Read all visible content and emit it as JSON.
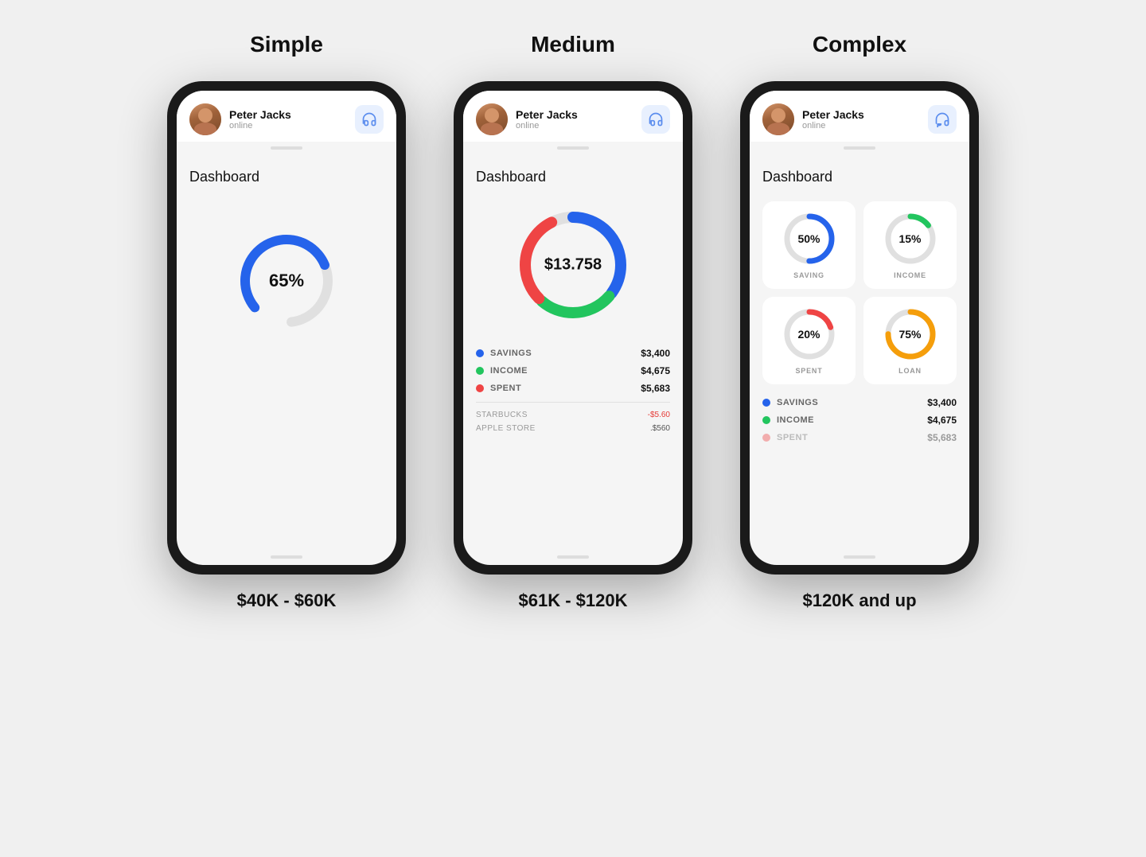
{
  "page": {
    "background": "#f0f0f0"
  },
  "columns": [
    {
      "id": "simple",
      "title": "Simple",
      "price_range": "$40K - $60K",
      "user": {
        "name": "Peter Jacks",
        "status": "online"
      },
      "dashboard_label": "Dashboard",
      "chart": {
        "type": "single_donut",
        "percentage": "65%",
        "value": 65,
        "color": "#2563EB",
        "track_color": "#e0e0e0"
      }
    },
    {
      "id": "medium",
      "title": "Medium",
      "price_range": "$61K - $120K",
      "user": {
        "name": "Peter Jacks",
        "status": "online"
      },
      "dashboard_label": "Dashboard",
      "chart": {
        "type": "multi_donut",
        "center_value": "$13.758",
        "segments": [
          {
            "label": "SAVINGS",
            "color": "#2563EB",
            "value": 35,
            "amount": "$3,400"
          },
          {
            "label": "INCOME",
            "color": "#22C55E",
            "value": 25,
            "amount": "$4,675"
          },
          {
            "label": "SPENT",
            "color": "#EF4444",
            "value": 30,
            "amount": "$5,683"
          }
        ]
      },
      "transactions": [
        {
          "label": "STARBUCKS",
          "value": "-$5.60",
          "red": true
        },
        {
          "label": "APPLE STORE",
          "value": ".$560",
          "red": false
        }
      ]
    },
    {
      "id": "complex",
      "title": "Complex",
      "price_range": "$120K and up",
      "user": {
        "name": "Peter Jacks",
        "status": "online"
      },
      "dashboard_label": "Dashboard",
      "grid_cards": [
        {
          "label": "SAVING",
          "percentage": "50%",
          "value": 50,
          "color": "#2563EB"
        },
        {
          "label": "INCOME",
          "percentage": "15%",
          "value": 15,
          "color": "#22C55E"
        },
        {
          "label": "SPENT",
          "percentage": "20%",
          "value": 20,
          "color": "#EF4444"
        },
        {
          "label": "LOAN",
          "percentage": "75%",
          "value": 75,
          "color": "#F59E0B"
        }
      ],
      "legend": [
        {
          "label": "SAVINGS",
          "color": "#2563EB",
          "amount": "$3,400"
        },
        {
          "label": "INCOME",
          "color": "#22C55E",
          "amount": "$4,675"
        },
        {
          "label": "SPENT",
          "color": "#EF4444",
          "amount": "$5,683",
          "faded": true
        }
      ]
    }
  ]
}
